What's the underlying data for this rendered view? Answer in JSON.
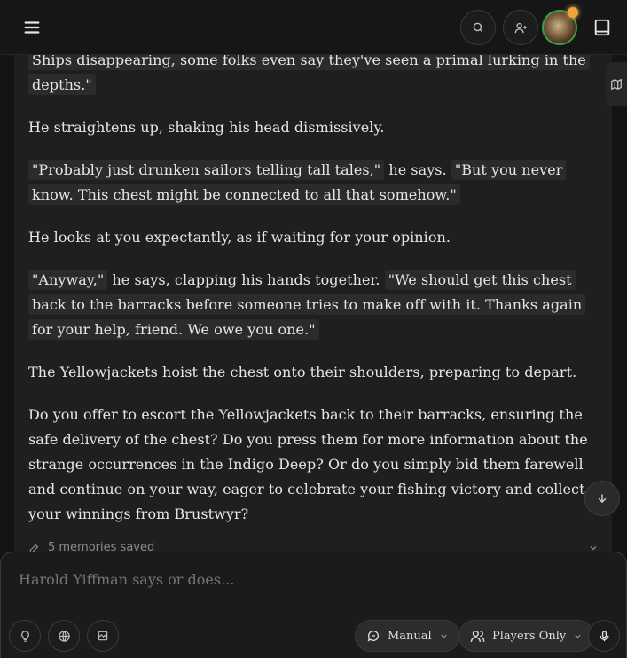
{
  "story": {
    "p1": "Ships disappearing, some folks even say they've seen a primal lurking in the depths.\"",
    "p2": "He straightens up, shaking his head dismissively.",
    "p3_quote1": "\"Probably just drunken sailors telling tall tales,\"",
    "p3_mid": " he says. ",
    "p3_quote2": "\"But you never know. This chest might be connected to all that somehow.\"",
    "p4": "He looks at you expectantly, as if waiting for your opinion.",
    "p5_quote1": "\"Anyway,\"",
    "p5_mid": " he says, clapping his hands together. ",
    "p5_quote2": "\"We should get this chest back to the barracks before someone tries to make off with it. Thanks again for your help, friend. We owe you one.\"",
    "p6": "The Yellowjackets hoist the chest onto their shoulders, preparing to depart.",
    "p7": "Do you offer to escort the Yellowjackets back to their barracks, ensuring the safe delivery of the chest? Do you press them for more information about the strange occurrences in the Indigo Deep? Or do you simply bid them farewell and continue on your way, eager to celebrate your fishing victory and collect your winnings from Brustwyr?"
  },
  "memories": {
    "label": "5 memories saved"
  },
  "composer": {
    "placeholder": "Harold Yiffman says or does...",
    "mode_label": "Manual",
    "visibility_label": "Players Only"
  },
  "colors": {
    "accent_green": "#37a24a",
    "background": "#141414",
    "card": "#1f1f1f"
  },
  "icons": [
    "menu-icon",
    "search-icon",
    "add-user-icon",
    "book-icon",
    "map-icon",
    "arrow-down-icon",
    "memory-icon",
    "chevron-down-icon",
    "lightbulb-icon",
    "globe-icon",
    "image-icon",
    "chat-icon",
    "users-icon",
    "mic-icon"
  ]
}
